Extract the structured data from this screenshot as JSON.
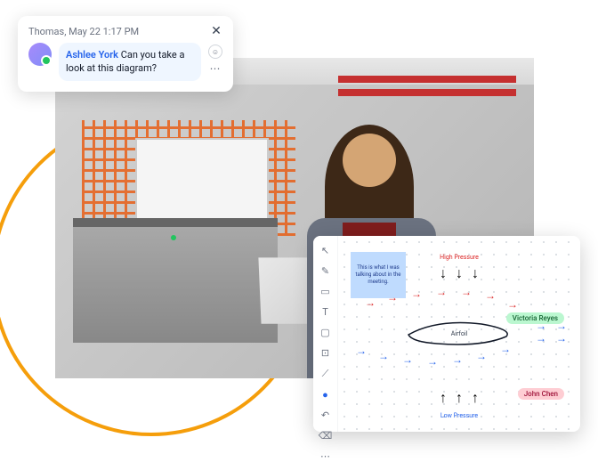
{
  "chat": {
    "timestamp": "Thomas, May 22 1:17 PM",
    "mention": "Ashlee York",
    "message": " Can you take a look at this diagram?"
  },
  "whiteboard": {
    "sticky_note": "This is what I was talking about in the meeting.",
    "label_high_pressure": "High Pressure",
    "label_low_pressure": "Low Pressure",
    "label_airfoil": "Airfoil",
    "user_tag_1": "Victoria Reyes",
    "user_tag_2": "John Chen"
  }
}
